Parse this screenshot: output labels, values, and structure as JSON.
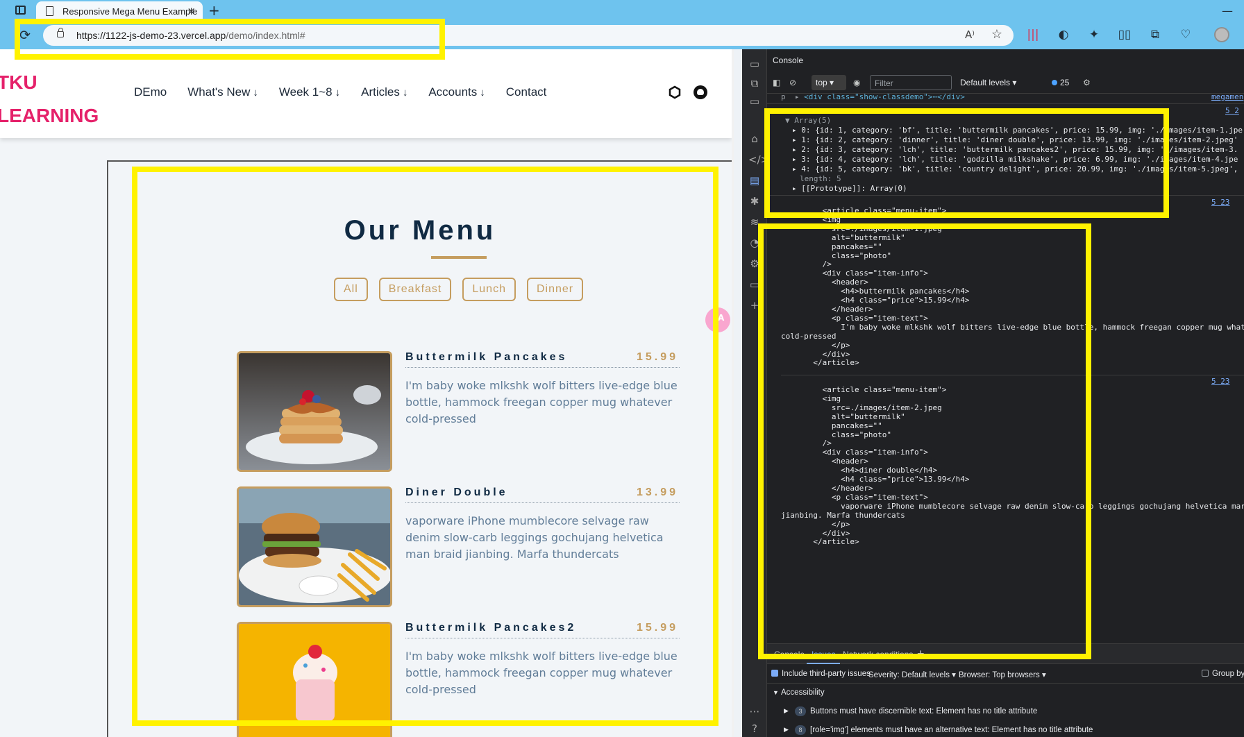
{
  "browser": {
    "tab_title": "Responsive Mega Menu Example",
    "tab_close": "×",
    "new_tab": "+",
    "minimize": "—",
    "url_domain": "https://1122-js-demo-23.vercel.app",
    "url_path": "/demo/index.html#",
    "read_aloud": "A⁾",
    "favorite": "☆",
    "extensions": [
      "|||",
      "◐",
      "☻",
      "✦",
      "▯▯",
      "⧉",
      "♡"
    ]
  },
  "site": {
    "logo_line1": "TKU",
    "logo_line2": "LEARNING",
    "nav": [
      {
        "label": "DEmo",
        "arrow": ""
      },
      {
        "label": "What's New",
        "arrow": "↓"
      },
      {
        "label": "Week 1~8",
        "arrow": "↓"
      },
      {
        "label": "Articles",
        "arrow": "↓"
      },
      {
        "label": "Accounts",
        "arrow": "↓"
      },
      {
        "label": "Contact",
        "arrow": ""
      }
    ],
    "menu_title": "Our Menu",
    "filters": [
      "All",
      "Breakfast",
      "Lunch",
      "Dinner"
    ],
    "float_label": "A",
    "items": [
      {
        "name": "Buttermilk Pancakes",
        "price": "15.99",
        "text": "I'm baby woke mlkshk wolf bitters live-edge blue bottle, hammock freegan copper mug whatever cold-pressed"
      },
      {
        "name": "Diner Double",
        "price": "13.99",
        "text": "vaporware iPhone mumblecore selvage raw denim slow-carb leggings gochujang helvetica man braid jianbing. Marfa thundercats"
      },
      {
        "name": "Buttermilk Pancakes2",
        "price": "15.99",
        "text": "I'm baby woke mlkshk wolf bitters live-edge blue bottle, hammock freegan copper mug whatever cold-pressed"
      }
    ]
  },
  "devtools": {
    "title": "Console",
    "context": "top ▾",
    "filter_placeholder": "Filter",
    "levels": "Default levels ▾",
    "count": "25",
    "top_line_prefix": "p  ▸",
    "top_line": "<div class=\"show-classdemo\">⋯</div>",
    "top_link": "megamen",
    "array_link": "5 2",
    "array_header": "▼ Array(5)",
    "array_rows": [
      "▸ 0: {id: 1, category: 'bf', title: 'buttermilk pancakes', price: 15.99, img: './images/item-1.jpe",
      "▸ 1: {id: 2, category: 'dinner', title: 'diner double', price: 13.99, img: './images/item-2.jpeg'",
      "▸ 2: {id: 3, category: 'lch', title: 'buttermilk pancakes2', price: 15.99, img: './images/item-3.",
      "▸ 3: {id: 4, category: 'lch', title: 'godzilla milkshake', price: 6.99, img: './images/item-4.jpe",
      "▸ 4: {id: 5, category: 'bk', title: 'country delight', price: 20.99, img: './images/item-5.jpeg',"
    ],
    "array_length": "length: 5",
    "array_proto": "▸ [[Prototype]]: Array(0)",
    "html_link": "5 23",
    "html_block_1": "         <article class=\"menu-item\">\n         <img\n           src=./images/item-1.jpeg\n           alt=\"buttermilk\"\n           pancakes=\"\"\n           class=\"photo\"\n         />\n         <div class=\"item-info\">\n           <header>\n             <h4>buttermilk pancakes</h4>\n             <h4 class=\"price\">15.99</h4>\n           </header>\n           <p class=\"item-text\">\n             I'm baby woke mlkshk wolf bitters live-edge blue bottle, hammock freegan copper mug whate\ncold-pressed\n           </p>\n         </div>\n       </article>",
    "html_block_2": "         <article class=\"menu-item\">\n         <img\n           src=./images/item-2.jpeg\n           alt=\"buttermilk\"\n           pancakes=\"\"\n           class=\"photo\"\n         />\n         <div class=\"item-info\">\n           <header>\n             <h4>diner double</h4>\n             <h4 class=\"price\">13.99</h4>\n           </header>\n           <p class=\"item-text\">\n             vaporware iPhone mumblecore selvage raw denim slow-carb leggings gochujang helvetica mar\njianbing. Marfa thundercats\n           </p>\n         </div>\n       </article>",
    "drawer_tabs": [
      "Console",
      "Issues",
      "Network conditions",
      "+"
    ],
    "issues_options": {
      "third_party": "Include third-party issues",
      "severity": "Severity:  Default levels ▾",
      "browser": "Browser:  Top browsers ▾",
      "group_by": "Group by k"
    },
    "issue_section": "Accessibility",
    "issues": [
      {
        "count": "3",
        "text": "Buttons must have discernible text: Element has no title attribute"
      },
      {
        "count": "8",
        "text": "[role='img'] elements must have an alternative text: Element has no title attribute"
      }
    ]
  },
  "colors": {
    "highlight": "#fff200",
    "accent": "#c59d5f",
    "brand_pink": "#e5216a",
    "devtools_bg": "#202124"
  }
}
